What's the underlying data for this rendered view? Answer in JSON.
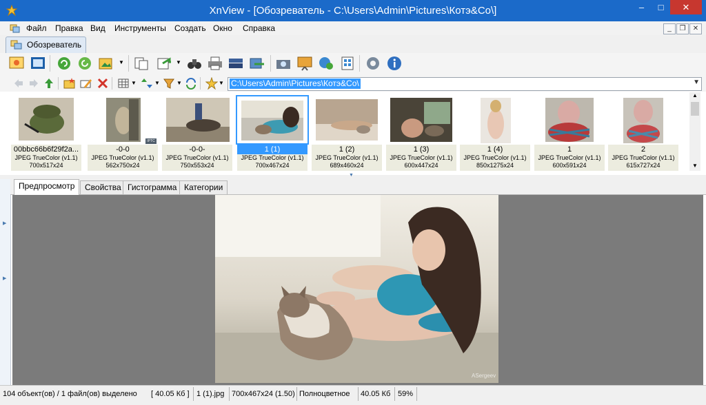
{
  "window": {
    "title": "XnView - [Обозреватель - C:\\Users\\Admin\\Pictures\\Котэ&Co\\]",
    "minimize": "–",
    "maximize": "□",
    "close": "✕"
  },
  "menu": [
    "Файл",
    "Правка",
    "Вид",
    "Инструменты",
    "Создать",
    "Окно",
    "Справка"
  ],
  "mdi": {
    "minimize": "_",
    "restore": "❐",
    "close": "✕"
  },
  "tab": {
    "label": "Обозреватель"
  },
  "address": {
    "value": "C:\\Users\\Admin\\Pictures\\Котэ&Co\\"
  },
  "thumbnails": [
    {
      "name": "00bbc66b6f29f2a...",
      "format": "JPEG TrueColor (v1.1)",
      "dims": "700x517x24"
    },
    {
      "name": "-0-0",
      "format": "JPEG TrueColor (v1.1)",
      "dims": "562x750x24",
      "badge": "IPTC"
    },
    {
      "name": "-0-0-",
      "format": "JPEG TrueColor (v1.1)",
      "dims": "750x553x24"
    },
    {
      "name": "1 (1)",
      "format": "JPEG TrueColor (v1.1)",
      "dims": "700x467x24",
      "selected": true
    },
    {
      "name": "1 (2)",
      "format": "JPEG TrueColor (v1.1)",
      "dims": "689x460x24"
    },
    {
      "name": "1 (3)",
      "format": "JPEG TrueColor (v1.1)",
      "dims": "600x447x24"
    },
    {
      "name": "1 (4)",
      "format": "JPEG TrueColor (v1.1)",
      "dims": "850x1275x24"
    },
    {
      "name": "1",
      "format": "JPEG TrueColor (v1.1)",
      "dims": "600x591x24"
    },
    {
      "name": "2",
      "format": "JPEG TrueColor (v1.1)",
      "dims": "615x727x24"
    }
  ],
  "preview_tabs": [
    "Предпросмотр",
    "Свойства",
    "Гистограмма",
    "Категории"
  ],
  "preview": {
    "watermark": "ASergeev"
  },
  "status": {
    "summary": "104 объект(ов) / 1 файл(ов) выделено",
    "selected_size": "[ 40.05 Кб ]",
    "filename": "1 (1).jpg",
    "image_info": "700x467x24 (1.50)",
    "color_mode": "Полноцветное",
    "file_size": "40.05 Кб",
    "zoom": "59%"
  },
  "colors": {
    "titlebar": "#1b6ac9",
    "selection": "#3399ff",
    "close_button": "#c7372f"
  }
}
